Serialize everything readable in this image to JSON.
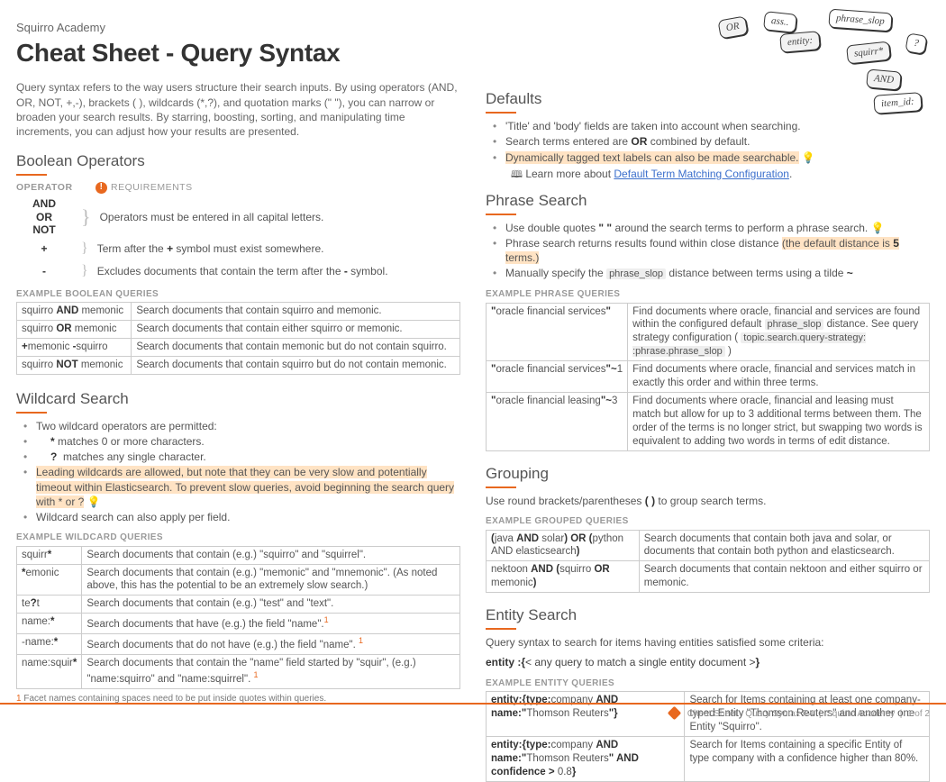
{
  "brand": "Squirro Academy",
  "title": "Cheat Sheet - Query Syntax",
  "intro": "Query syntax refers to the way users structure their search inputs. By using operators (AND, OR, NOT, +,-), brackets ( ), wildcards (*,?), and quotation marks (\" \"), you can narrow or broaden your search results. By starring, boosting, sorting, and manipulating time increments, you can adjust how your results are presented.",
  "bool": {
    "heading": "Boolean Operators",
    "hdr_op": "OPERATOR",
    "hdr_req": "REQUIREMENTS",
    "caps": "Operators must be entered in all capital letters.",
    "plus_op": "+",
    "plus": "Term after the + symbol must exist somewhere.",
    "minus_op": "-",
    "minus": "Excludes documents that contain the term after the - symbol.",
    "and": "AND",
    "or": "OR",
    "not": "NOT",
    "example_label": "EXAMPLE BOOLEAN QUERIES",
    "rows": [
      {
        "q": "squirro AND memonic",
        "d": "Search documents that contain squirro and memonic."
      },
      {
        "q": "squirro OR memonic",
        "d": "Search documents that contain either squirro or memonic."
      },
      {
        "q": "+memonic -squirro",
        "d": "Search documents that contain memonic but do not contain squirro."
      },
      {
        "q": "squirro NOT memonic",
        "d": "Search documents that contain squirro but do not contain memonic."
      }
    ]
  },
  "wild": {
    "heading": "Wildcard Search",
    "b1": "Two wildcard operators are permitted:",
    "b2": "* matches 0 or more characters.",
    "b3": "? matches any single character.",
    "b4": "Leading wildcards are allowed, but note that they can be very slow and potentially timeout within Elasticsearch. To prevent slow queries, avoid beginning the search query with * or ?",
    "b5": "Wildcard search can also apply per field.",
    "example_label": "EXAMPLE WILDCARD QUERIES",
    "rows": [
      {
        "q": "squirr*",
        "d": "Search documents that contain (e.g.) \"squirro\" and \"squirrel\"."
      },
      {
        "q": "*emonic",
        "d": "Search documents that contain (e.g.) \"memonic\" and \"mnemonic\". (As noted above, this has the potential to be an extremely slow search.)"
      },
      {
        "q": "te?t",
        "d": "Search documents that contain (e.g.) \"test\" and \"text\"."
      },
      {
        "q": "name:*",
        "d": "Search documents that have (e.g.) the field \"name\"."
      },
      {
        "q": "-name:*",
        "d": "Search documents that do not have (e.g.) the field \"name\"."
      },
      {
        "q": "name:squir*",
        "d": "Search documents that contain the \"name\" field started by \"squir\", (e.g.) \"name:squirro\" and \"name:squirrel\"."
      }
    ],
    "foot": "Facet names containing spaces need to be put inside quotes within queries."
  },
  "defaults": {
    "heading": "Defaults",
    "b1": "'Title' and 'body' fields are taken into account when searching.",
    "b2a": "Search terms entered are ",
    "b2b": "OR",
    "b2c": " combined by default.",
    "b3": "Dynamically tagged text labels can also be made searchable.",
    "learn_pre": "Learn more about ",
    "learn_link": "Default Term Matching Configuration",
    "learn_suf": "."
  },
  "phrase": {
    "heading": "Phrase Search",
    "b1a": "Use double quotes ",
    "b1b": "\" \"",
    "b1c": " around the search terms to perform a phrase search.",
    "b2a": "Phrase search returns results found within close distance ",
    "b2b": "(the default distance is 5 terms.)",
    "b3a": "Manually specify the ",
    "b3b": "phrase_slop",
    "b3c": " distance between terms using a tilde ",
    "b3d": "~",
    "example_label": "EXAMPLE PHRASE QUERIES",
    "rows": [
      {
        "q": "\"oracle financial services\"",
        "d": "Find documents where oracle, financial and services are found within the configured default phrase_slop distance. See query strategy configuration ( topic.search.query-strategy: :phrase.phrase_slop )"
      },
      {
        "q": "\"oracle financial services\"~1",
        "d": "Find documents where oracle, financial and services match in exactly this order and within three terms."
      },
      {
        "q": "\"oracle financial leasing\"~3",
        "d": "Find documents where oracle, financial and leasing must match but allow for up to 3 additional terms between them. The order of the terms is no longer strict, but swapping two words is equivalent to adding two words in terms of edit distance."
      }
    ]
  },
  "group": {
    "heading": "Grouping",
    "desc_a": "Use round brackets/parentheses ",
    "desc_b": "( )",
    "desc_c": " to group search terms.",
    "example_label": "EXAMPLE GROUPED QUERIES",
    "rows": [
      {
        "q": "(java AND solar) OR (python AND elasticsearch)",
        "d": "Search documents that contain both java and solar, or documents that contain both python and elasticsearch."
      },
      {
        "q": "nektoon AND (squirro OR memonic)",
        "d": "Search documents that contain nektoon and either squirro or memonic."
      }
    ]
  },
  "entity": {
    "heading": "Entity Search",
    "desc": "Query syntax to search for items having entities satisfied some criteria:",
    "syntax_a": "entity :{",
    "syntax_b": "< any query to match a single entity document >",
    "syntax_c": "}",
    "example_label": "EXAMPLE ENTITY QUERIES",
    "rows": [
      {
        "q": "entity:{type:company AND name:\"Thomson Reuters\"}",
        "d": "Search for Items containing at least one company-typed Entity \"Thomson Reuters\" and another one Entity \"Squirro\"."
      },
      {
        "q": "entity:{type:company AND name:\"Thomson Reuters\" AND confidence > 0.8}",
        "d": "Search for Items containing a specific Entity of type company with a confidence higher than 80%."
      }
    ]
  },
  "bubbles": [
    "OR",
    "ass..",
    "entity:",
    "phrase_slop",
    "squirr*",
    "?",
    "AND",
    "item_id:"
  ],
  "footer": {
    "a": "Cheat Sheet - Query Syntax R4",
    "b": "Squirro Academy",
    "c": "1 of 2"
  }
}
